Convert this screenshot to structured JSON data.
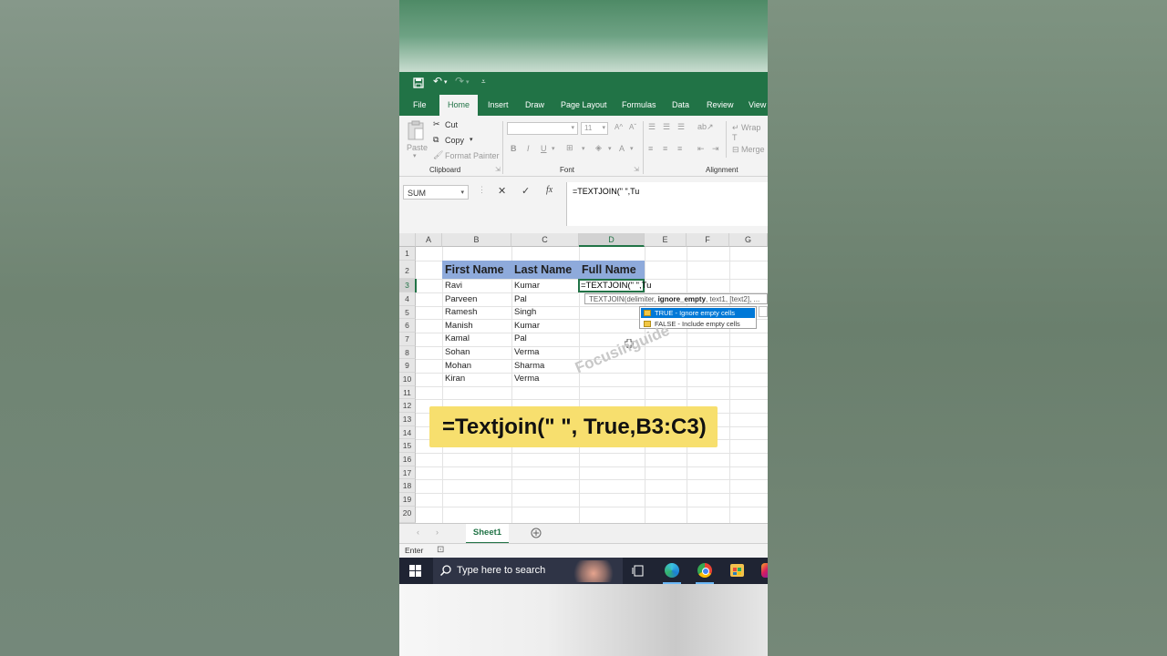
{
  "qat": {
    "save_icon": "save-icon",
    "undo_icon": "undo-icon",
    "redo_icon": "redo-icon",
    "customize_icon": "customize-icon"
  },
  "ribbon_tabs": [
    "File",
    "Home",
    "Insert",
    "Draw",
    "Page Layout",
    "Formulas",
    "Data",
    "Review",
    "View"
  ],
  "active_tab": "Home",
  "clipboard": {
    "paste": "Paste",
    "cut": "Cut",
    "copy": "Copy",
    "format_painter": "Format Painter",
    "group": "Clipboard"
  },
  "font": {
    "size": "11",
    "bold": "B",
    "italic": "I",
    "underline": "U",
    "font_color": "A",
    "group": "Font"
  },
  "alignment": {
    "wrap": "Wrap T",
    "merge": "Merge",
    "group": "Alignment"
  },
  "formula_bar": {
    "name_box": "SUM",
    "formula": "=TEXTJOIN(\" \",Tu"
  },
  "columns": [
    "A",
    "B",
    "C",
    "D",
    "E",
    "F",
    "G"
  ],
  "active_column": "D",
  "rows": [
    "1",
    "2",
    "3",
    "4",
    "5",
    "6",
    "7",
    "8",
    "9",
    "10",
    "11",
    "12",
    "13",
    "14",
    "15",
    "16",
    "17",
    "18",
    "19",
    "20"
  ],
  "table": {
    "headers": [
      "First Name",
      "Last Name",
      "Full Name"
    ],
    "data": [
      [
        "Ravi",
        "Kumar"
      ],
      [
        "Parveen",
        "Pal"
      ],
      [
        "Ramesh",
        "Singh"
      ],
      [
        "Manish",
        "Kumar"
      ],
      [
        "Kamal",
        "Pal"
      ],
      [
        "Sohan",
        "Verma"
      ],
      [
        "Mohan",
        "Sharma"
      ],
      [
        "Kiran",
        "Verma"
      ]
    ]
  },
  "active_cell_text": "=TEXTJOIN(\" \",Tu",
  "tooltip_pre": "TEXTJOIN(delimiter, ",
  "tooltip_bold": "ignore_empty",
  "tooltip_post": ", text1, [text2], ...",
  "autocomplete": [
    "TRUE - Ignore empty cells",
    "FALSE - Include empty cells"
  ],
  "banner": "=Textjoin(\" \", True,B3:C3)",
  "watermark": "Focusinguide",
  "sheet_tab": "Sheet1",
  "status": "Enter",
  "taskbar_search": "Type here to search",
  "colors": {
    "excel_green": "#217346",
    "header_fill": "#8eaadb",
    "banner": "#f7df6e",
    "selection": "#0078d7"
  }
}
